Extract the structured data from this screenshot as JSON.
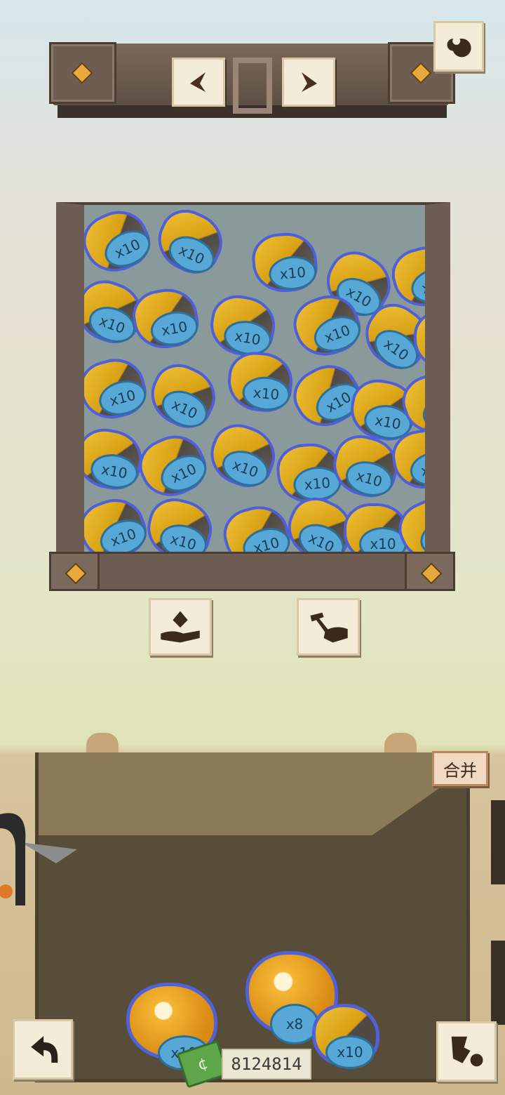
{
  "merge_button": {
    "label": "合并"
  },
  "money": {
    "amount": "8124814",
    "icon": "cash-icon"
  },
  "top_nav": {
    "prev_icon": "arrow-left-icon",
    "next_icon": "arrow-right-icon",
    "corner_icon": "rock-cluster-icon"
  },
  "tools": {
    "left_icon": "hand-give-icon",
    "right_icon": "hammer-hand-icon"
  },
  "bottom": {
    "back_icon": "back-arrow-icon",
    "map_icon": "map-pets-icon"
  },
  "box_nuggets": {
    "multiplier": "x10"
  },
  "sack_nuggets": [
    {
      "multiplier": "x10"
    },
    {
      "multiplier": "x8"
    },
    {
      "multiplier": "x10"
    }
  ]
}
